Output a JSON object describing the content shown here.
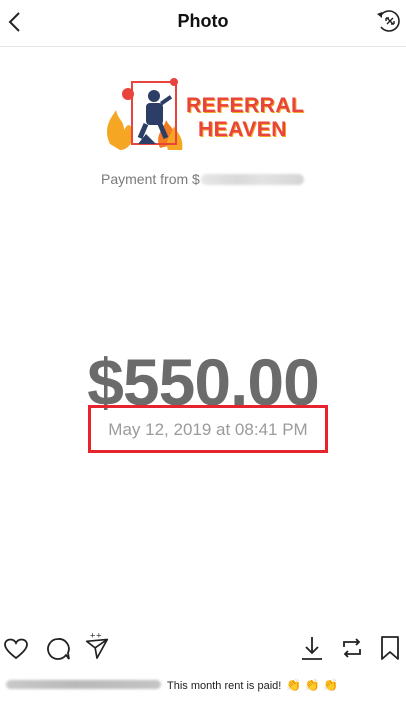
{
  "header": {
    "title": "Photo"
  },
  "logo": {
    "line1": "REFERRAL",
    "line2": "HEAVEN"
  },
  "payment": {
    "label": "Payment from $"
  },
  "amount": "$550.00",
  "date": "May 12, 2019 at 08:41 PM",
  "caption": {
    "text": "This month rent is paid!",
    "emoji": "👏 👏 👏"
  },
  "colors": {
    "highlight": "#e5242d",
    "amount": "#6b6b6b",
    "logo_orange": "#f5a623",
    "logo_red": "#e8433c"
  }
}
